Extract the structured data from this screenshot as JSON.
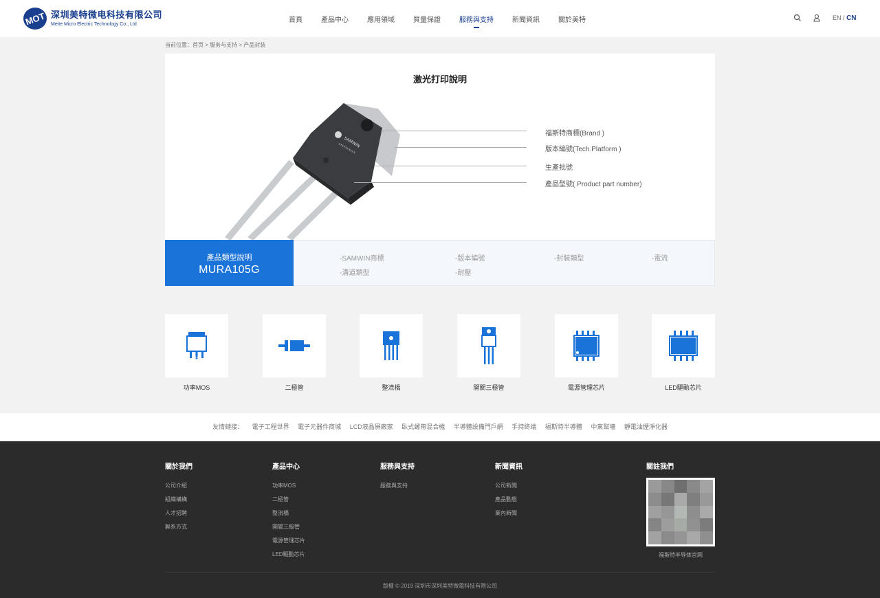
{
  "header": {
    "logo_cn": "深圳美特微电科技有限公司",
    "logo_en": "Meite Micro Electric Technology Co., Ltd",
    "nav": [
      "首頁",
      "產品中心",
      "應用領域",
      "質量保證",
      "服務與支持",
      "新聞資訊",
      "關於美特"
    ],
    "active_nav": "服務與支持",
    "lang_en": "EN",
    "lang_sep": "/",
    "lang_cn": "CN"
  },
  "breadcrumb": "当前位置：首页 > 服务与支持 > 产品封装",
  "card": {
    "title": "激光打印說明",
    "labels": [
      "福斯特商標(Brand )",
      "版本編號(Tech.Platform )",
      "生產批號",
      "產品型號( Product part number)"
    ]
  },
  "type_band": {
    "heading": "產品類型說明",
    "model": "MURA105G",
    "items": [
      "-SAMWIN商標",
      "-版本編號",
      "-封裝類型",
      "-電流",
      "-溝道類型",
      "-耐壓"
    ]
  },
  "categories": [
    "功率MOS",
    "二極管",
    "整流橋",
    "開關三極管",
    "電源管理芯片",
    "LED驅動芯片"
  ],
  "links": {
    "label": "友情鏈接：",
    "items": [
      "電子工程世界",
      "電子元器件商城",
      "LCD液晶屏廠家",
      "臥式螺帶混合機",
      "半導體設備門戶網",
      "手持終端",
      "福斯特半導體",
      "中東幫墻",
      "靜電油煙淨化器"
    ]
  },
  "footer": {
    "about": {
      "title": "關於我們",
      "items": [
        "公司介紹",
        "組織構構",
        "人才招聘",
        "聯系方式"
      ]
    },
    "products": {
      "title": "產品中心",
      "items": [
        "功率MOS",
        "二極管",
        "整流橋",
        "開關三級管",
        "電源管理芯片",
        "LED驅動芯片"
      ]
    },
    "service": {
      "title": "服務與支持",
      "items": [
        "服務與支持"
      ]
    },
    "news": {
      "title": "新聞資訊",
      "items": [
        "公司新聞",
        "產品動態",
        "業內新聞"
      ]
    },
    "follow": {
      "title": "關註我們",
      "qr_caption": "福斯特半导体官网"
    },
    "copyright": "版權 © 2019 深圳市深圳美特微電科技有限公司"
  },
  "colors": {
    "brand": "#1a3f8f",
    "accent": "#1a73d9",
    "footer_bg": "#2b2b2b"
  }
}
